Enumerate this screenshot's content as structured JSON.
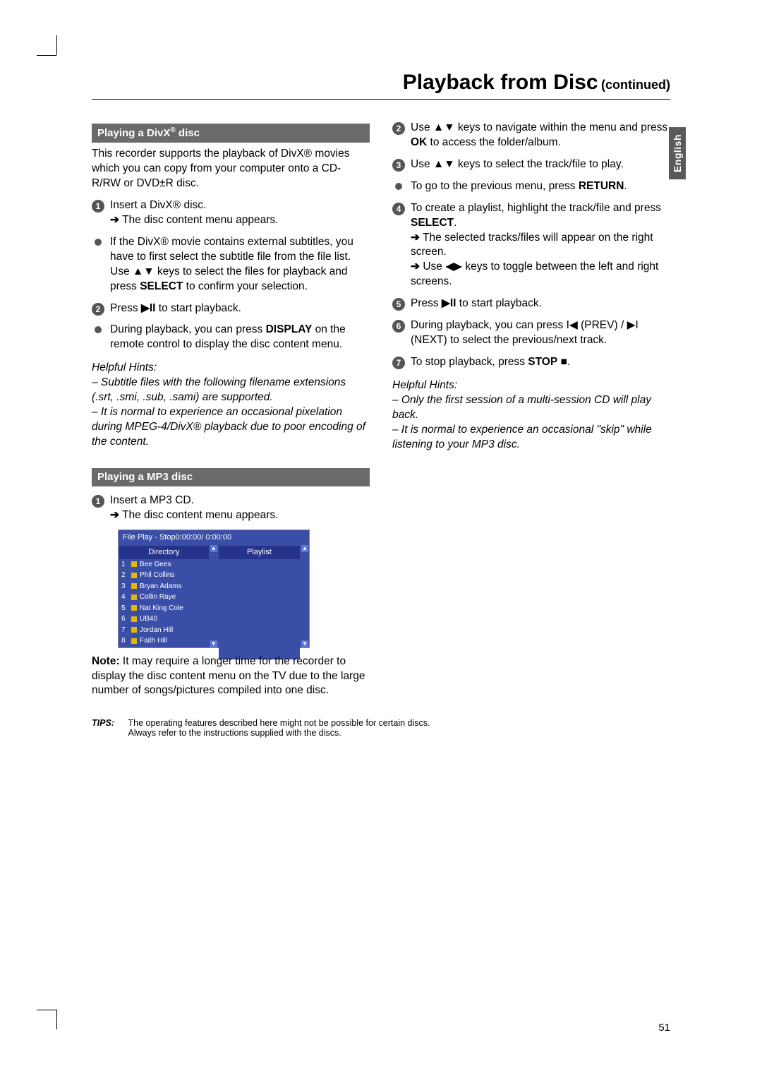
{
  "title": "Playback from Disc",
  "title_cont": "(continued)",
  "side_tab": "English",
  "page_number": "51",
  "sections": {
    "divx": {
      "header": "Playing a DivX® disc",
      "intro": "This recorder supports the playback of DivX® movies which you can copy from your computer onto a CD-R/RW or DVD±R disc.",
      "step1": "Insert a DivX® disc.",
      "step1_sub": "The disc content menu appears.",
      "bullet1a": "If the DivX® movie contains external subtitles, you have to first select the subtitle file from the file list.",
      "bullet1b_pre": "Use ",
      "bullet1b_post": " keys to select the files for playback and press ",
      "bullet1b_bold": "SELECT",
      "bullet1b_end": " to confirm your selection.",
      "step2_pre": "Press ",
      "step2_post": " to start playback.",
      "bullet2_pre": "During playback, you can press ",
      "bullet2_bold": "DISPLAY",
      "bullet2_post": " on the remote control to display the disc content menu.",
      "hints_label": "Helpful Hints:",
      "hint1": "– Subtitle files with the following filename extensions (.srt, .smi, .sub, .sami) are supported.",
      "hint2": "– It is normal to experience an occasional pixelation during MPEG-4/DivX® playback due to poor encoding of the content."
    },
    "mp3": {
      "header": "Playing a MP3 disc",
      "step1": "Insert a MP3 CD.",
      "step1_sub": "The disc content menu appears.",
      "ui_title": "File Play - Stop0:00:00/ 0:00:00",
      "ui_dir": "Directory",
      "ui_playlist": "Playlist",
      "ui_items": [
        "Bee Gees",
        "Phil Collins",
        "Bryan Adams",
        "Collin Raye",
        "Nat King Cole",
        "UB40",
        "Jordan Hill",
        "Faith Hill"
      ],
      "note_label": "Note:",
      "note_text": " It may require a longer time for the recorder to display the disc content menu on the TV due to the large number of songs/pictures compiled into one disc."
    },
    "right": {
      "step2_pre": "Use ",
      "step2_mid": " keys to navigate within the menu and press ",
      "step2_bold": "OK",
      "step2_post": " to access the folder/album.",
      "step3_pre": "Use ",
      "step3_post": " keys to select the track/file to play.",
      "bullet_pre": "To go to the previous menu, press ",
      "bullet_bold": "RETURN",
      "bullet_post": ".",
      "step4_pre": "To create a playlist, highlight the track/file and press ",
      "step4_bold": "SELECT",
      "step4_post": ".",
      "step4_sub1": "The selected tracks/files will appear on the right screen.",
      "step4_sub2_pre": "Use ",
      "step4_sub2_post": " keys to toggle between the left and right screens.",
      "step5_pre": "Press ",
      "step5_post": " to start playback.",
      "step6_pre": "During playback, you can press ",
      "step6_mid": " (PREV) / ",
      "step6_post": " (NEXT) to select the previous/next track.",
      "step7_pre": "To stop playback, press ",
      "step7_bold": "STOP",
      "step7_post": " ",
      "hints_label": "Helpful Hints:",
      "hint1": "– Only the first session of a multi-session CD will play back.",
      "hint2": "– It is normal to experience an occasional \"skip\" while listening to your MP3 disc."
    }
  },
  "tips": {
    "label": "TIPS:",
    "line1": "The operating features described here might not be possible for certain discs.",
    "line2": "Always refer to the instructions supplied with the discs."
  },
  "icons": {
    "updown": "▲▼",
    "leftright": "◀▶",
    "playpause": "▶II",
    "prev": "I◀",
    "next": "▶I",
    "stop": "■",
    "arrow": "➔"
  }
}
